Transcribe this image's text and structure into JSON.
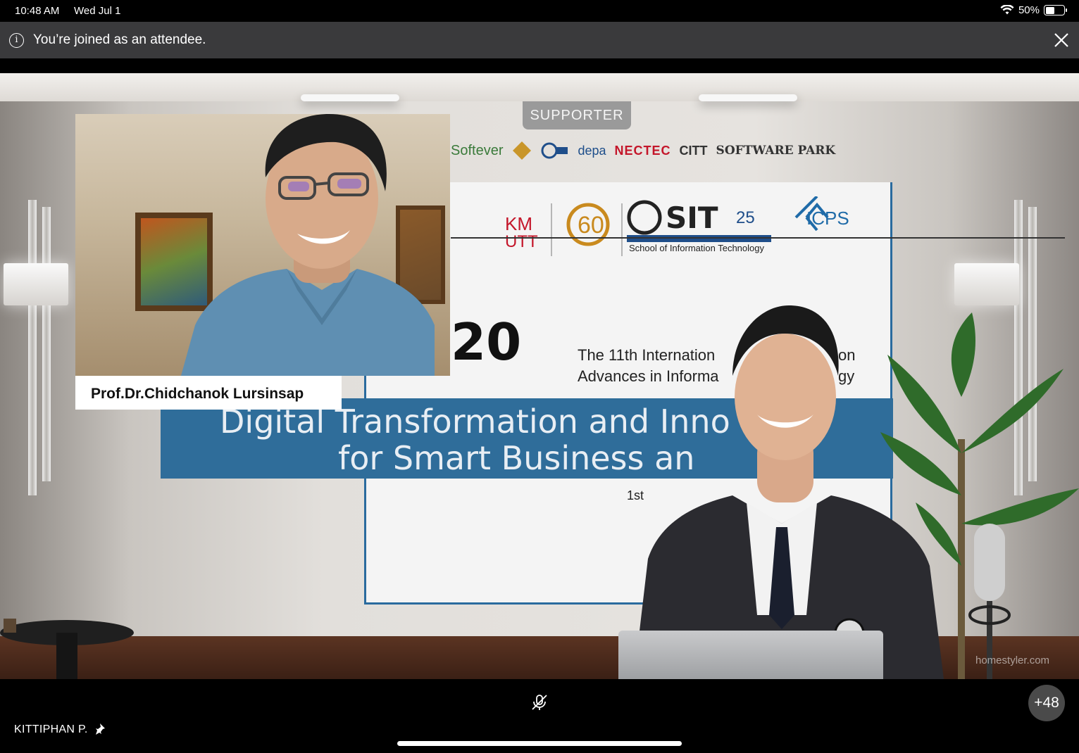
{
  "status_bar": {
    "time": "10:48 AM",
    "date": "Wed Jul 1",
    "battery": "50%",
    "icons": [
      "wifi-icon",
      "battery-icon"
    ]
  },
  "banner": {
    "message": "You’re joined as an attendee.",
    "info_icon": "info-icon",
    "close_icon": "close-icon"
  },
  "stage": {
    "supporter_label": "SUPPORTER",
    "logos": [
      "Softever",
      "depa",
      "NECTEC",
      "CITT",
      "SOFTWARE PARK"
    ],
    "institution": "School of Information Technology",
    "institution_logos": [
      "KMUTT",
      "SIT",
      "ICPS"
    ],
    "year_fragment": "20",
    "conference_line1": "The 11th Internation",
    "conference_line2": "Advances in Informa",
    "conference_line1_end": "on",
    "conference_line2_end": "gy",
    "title_line1": "Digital Transformation and Inno     on",
    "title_line2": "for Smart Business an",
    "date_fragment": "1st",
    "watermark": "homestyler.com"
  },
  "speaker_pip": {
    "name": "Prof.Dr.Chidchanok Lursinsap"
  },
  "bottom": {
    "mic_icon": "mic-muted-icon",
    "more_participants": "+48",
    "presenter": "KITTIPHAN P.",
    "pin_icon": "pin-icon"
  }
}
